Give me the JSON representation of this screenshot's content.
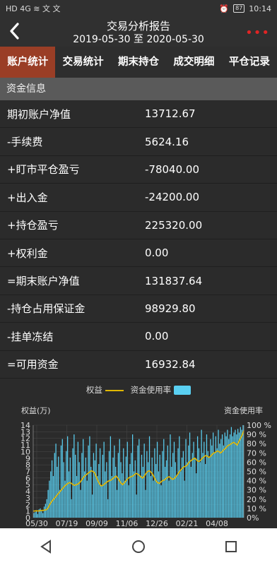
{
  "status": {
    "left": "HD 4G ≋ 文 文",
    "battery": "87",
    "time": "10:14"
  },
  "header": {
    "title": "交易分析报告",
    "subtitle": "2019-05-30 至 2020-05-30"
  },
  "tabs": [
    "账户统计",
    "交易统计",
    "期末持仓",
    "成交明细",
    "平仓记录"
  ],
  "section": {
    "title": "资金信息"
  },
  "rows": [
    {
      "label": "期初账户净值",
      "value": "13712.67"
    },
    {
      "label": "-手续费",
      "value": "5624.16"
    },
    {
      "label": "+盯市平仓盈亏",
      "value": "-78040.00"
    },
    {
      "label": "+出入金",
      "value": "-24200.00"
    },
    {
      "label": "+持仓盈亏",
      "value": "225320.00"
    },
    {
      "label": "+权利金",
      "value": "0.00"
    },
    {
      "label": "=期末账户净值",
      "value": "131837.64"
    },
    {
      "label": "-持仓占用保证金",
      "value": "98929.80"
    },
    {
      "label": "-挂单冻结",
      "value": "0.00"
    },
    {
      "label": "=可用资金",
      "value": "16932.84"
    }
  ],
  "chart_data": {
    "type": "bar",
    "legend": {
      "line": "权益",
      "bar": "资金使用率"
    },
    "ylabel_left": "权益(万)",
    "ylabel_right": "资金使用率",
    "y_left_ticks": [
      "0",
      "1",
      "2",
      "3",
      "4",
      "5",
      "6",
      "7",
      "8",
      "9",
      "10",
      "11",
      "12",
      "13",
      "14"
    ],
    "y_right_ticks": [
      "0%",
      "10 %",
      "20 %",
      "30 %",
      "40 %",
      "50 %",
      "60 %",
      "70 %",
      "80 %",
      "90 %",
      "100 %"
    ],
    "x_ticks": [
      "05/30",
      "07/19",
      "09/09",
      "11/06",
      "12/26",
      "02/21",
      "04/08"
    ],
    "usage_rate": [
      5,
      6,
      8,
      4,
      9,
      10,
      7,
      5,
      12,
      15,
      20,
      30,
      40,
      50,
      62,
      45,
      70,
      80,
      55,
      66,
      30,
      78,
      85,
      60,
      40,
      72,
      88,
      50,
      65,
      20,
      75,
      90,
      68,
      45,
      82,
      60,
      30,
      70,
      85,
      50,
      65,
      40,
      78,
      88,
      55,
      25,
      70,
      62,
      80,
      45,
      58,
      75,
      35,
      68,
      82,
      50,
      60,
      20,
      72,
      88,
      45,
      65,
      78,
      55,
      30,
      70,
      85,
      60,
      48,
      75,
      40,
      66,
      82,
      35,
      58,
      70,
      90,
      50,
      62,
      25,
      78,
      85,
      45,
      68,
      55,
      80,
      30,
      72,
      60,
      88,
      45,
      65,
      40,
      75,
      58,
      82,
      50,
      68,
      35,
      72,
      85,
      55,
      62,
      78,
      40,
      90,
      55,
      70,
      82,
      60,
      45,
      75,
      88,
      50,
      65,
      72,
      40,
      85,
      60,
      78,
      92,
      55,
      70,
      82,
      65,
      48,
      88,
      75,
      60,
      95,
      70,
      82,
      58,
      90,
      72,
      65,
      85,
      78,
      92,
      70,
      88,
      75,
      95,
      80,
      85,
      90,
      78,
      92,
      88,
      95,
      85,
      90,
      98,
      88,
      92,
      95,
      90,
      96,
      92,
      98,
      95,
      100
    ],
    "equity": [
      1.0,
      1.0,
      1.05,
      1.0,
      1.05,
      1.1,
      1.1,
      1.15,
      1.2,
      1.5,
      2.0,
      2.4,
      2.7,
      3.0,
      3.3,
      3.6,
      3.9,
      4.2,
      4.5,
      4.8,
      5.0,
      5.2,
      5.3,
      5.2,
      5.0,
      4.9,
      5.0,
      5.1,
      5.3,
      5.6,
      6.0,
      6.3,
      6.5,
      6.7,
      6.9,
      7.1,
      7.0,
      6.8,
      6.2,
      5.6,
      5.1,
      4.8,
      4.9,
      5.1,
      5.3,
      5.5,
      5.6,
      5.7,
      5.9,
      6.1,
      6.3,
      6.0,
      5.6,
      5.2,
      5.0,
      5.3,
      5.6,
      5.9,
      6.1,
      6.2,
      6.3,
      6.5,
      6.7,
      6.6,
      6.4,
      6.2,
      6.0,
      6.3,
      6.7,
      7.0,
      7.1,
      6.9,
      6.6,
      6.1,
      5.6,
      5.3,
      5.2,
      5.4,
      5.6,
      5.7,
      5.9,
      6.1,
      6.2,
      6.0,
      5.8,
      5.9,
      6.2,
      6.5,
      6.9,
      7.2,
      7.5,
      7.7,
      7.8,
      8.0,
      8.4,
      8.6,
      8.8,
      9.0,
      8.9,
      8.6,
      8.5,
      8.7,
      9.0,
      9.2,
      9.4,
      9.3,
      9.1,
      9.3,
      9.6,
      9.8,
      9.9,
      10.1,
      10.0,
      9.8,
      10.0,
      10.3,
      10.5,
      10.8,
      11.0,
      11.1,
      11.3,
      11.4,
      11.2,
      11.0,
      11.5,
      12.0,
      12.5,
      13.2
    ]
  },
  "nav": {
    "back": "back-triangle",
    "home": "home-circle",
    "recent": "recent-square"
  }
}
